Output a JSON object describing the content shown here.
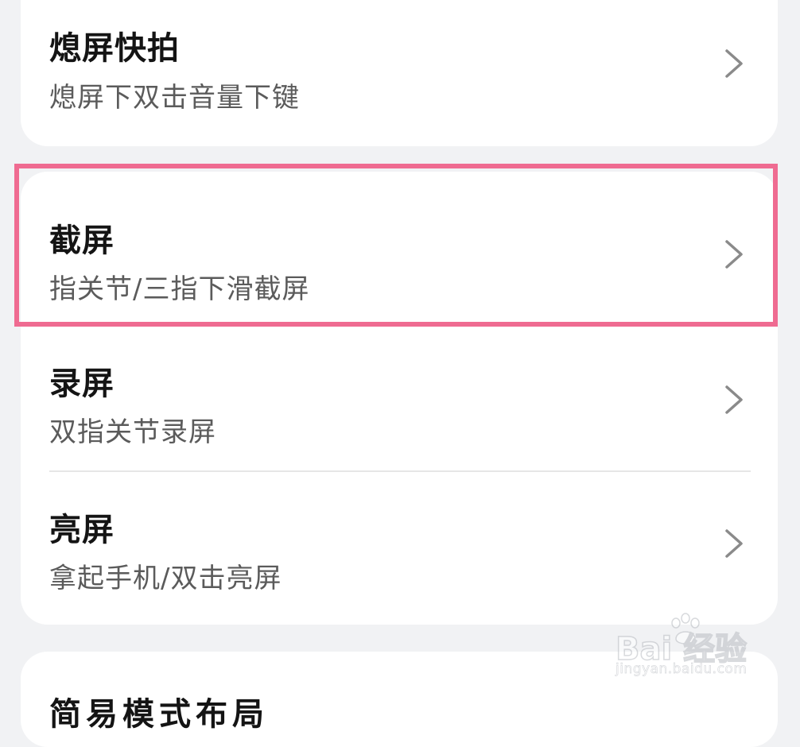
{
  "settings_list": {
    "top_item": {
      "title": "熄屏快拍",
      "subtitle": "熄屏下双击音量下键",
      "icon": "chevron-right-icon"
    },
    "items": [
      {
        "title": "截屏",
        "subtitle": "指关节/三指下滑截屏",
        "icon": "chevron-right-icon",
        "highlighted": true
      },
      {
        "title": "录屏",
        "subtitle": "双指关节录屏",
        "icon": "chevron-right-icon"
      },
      {
        "title": "亮屏",
        "subtitle": "拿起手机/双击亮屏",
        "icon": "chevron-right-icon"
      }
    ],
    "bottom_item": {
      "title": "简易模式布局"
    }
  },
  "highlight": {
    "color": "#ef6b91"
  },
  "watermark": {
    "logo": "Bai  经验",
    "url": "jingyan.baidu.com"
  },
  "colors": {
    "background": "#f1f2f4",
    "card": "#ffffff",
    "title_text": "#141414",
    "subtitle_text": "#5b5b5b",
    "chevron": "#8a8a8a"
  }
}
